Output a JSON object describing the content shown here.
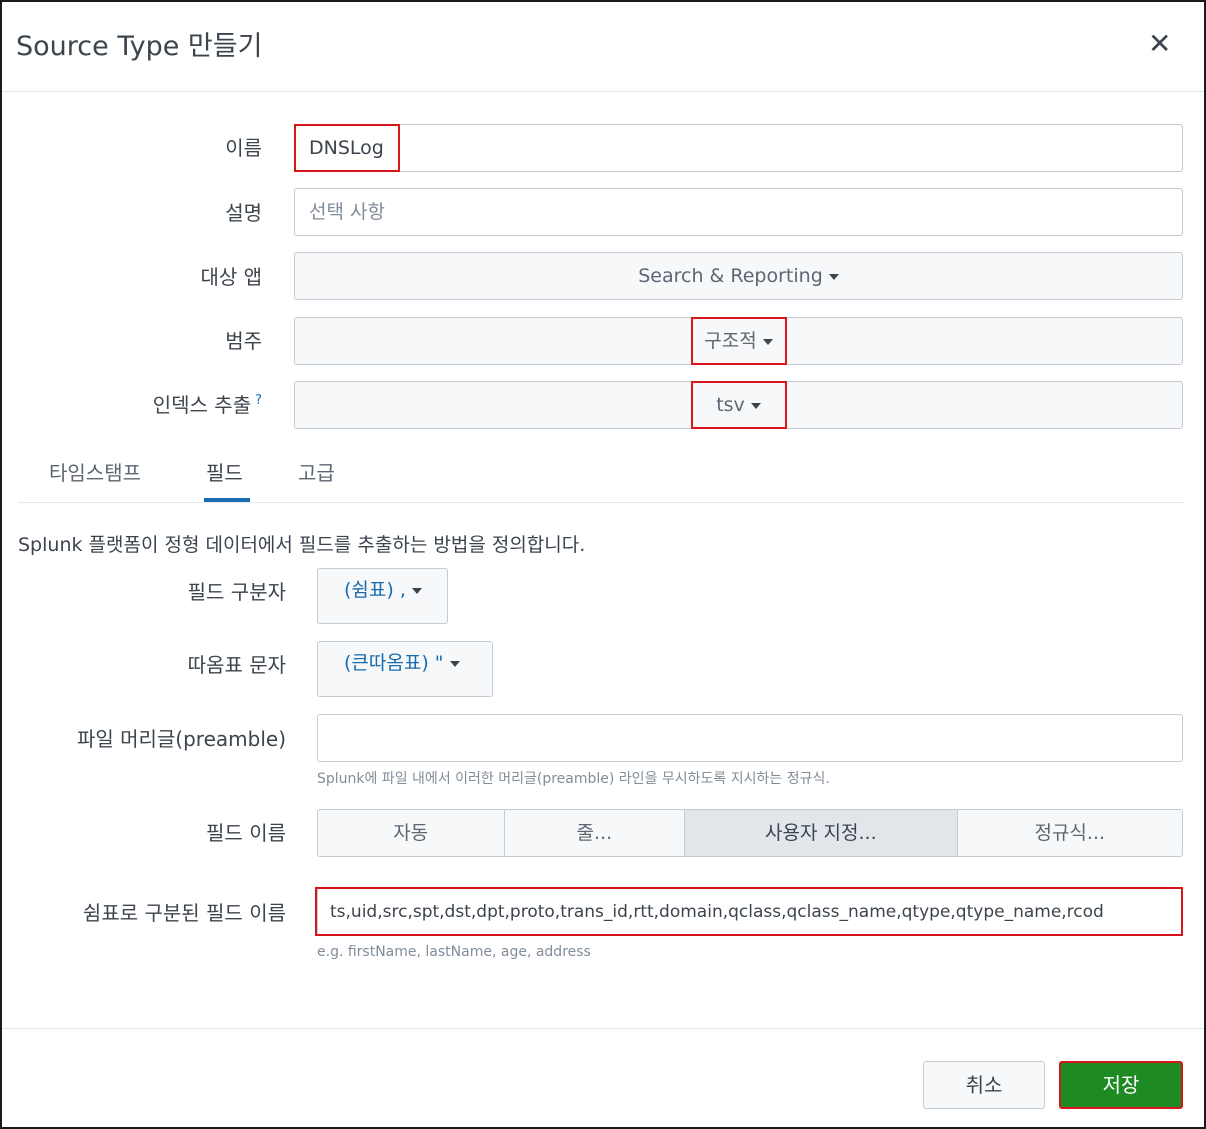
{
  "dialog": {
    "title": "Source Type 만들기",
    "close_glyph": "✕"
  },
  "form": {
    "name_label": "이름",
    "name_value": "DNSLog",
    "description_label": "설명",
    "description_placeholder": "선택 사항",
    "target_app_label": "대상 앱",
    "target_app_value": "Search & Reporting",
    "category_label": "범주",
    "category_value": "구조적",
    "index_extraction_label": "인덱스 추출",
    "index_extraction_help": "?",
    "index_extraction_value": "tsv"
  },
  "tabs": [
    {
      "label": "타임스탬프",
      "active": false
    },
    {
      "label": "필드",
      "active": true
    },
    {
      "label": "고급",
      "active": false
    }
  ],
  "fields_tab": {
    "description": "Splunk 플랫폼이 정형 데이터에서 필드를 추출하는 방법을 정의합니다.",
    "delimiter_label": "필드 구분자",
    "delimiter_value": "(쉼표) ,",
    "quote_label": "따옴표 문자",
    "quote_value": "(큰따옴표) \"",
    "preamble_label": "파일 머리글(preamble)",
    "preamble_value": "",
    "preamble_help": "Splunk에 파일 내에서 이러한 머리글(preamble) 라인을 무시하도록 지시하는 정규식.",
    "field_names_label": "필드 이름",
    "field_names_options": [
      {
        "label": "자동",
        "active": false
      },
      {
        "label": "줄...",
        "active": false
      },
      {
        "label": "사용자 지정...",
        "active": true
      },
      {
        "label": "정규식...",
        "active": false
      }
    ],
    "csv_names_label": "쉼표로 구분된 필드 이름",
    "csv_names_value": "ts,uid,src,spt,dst,dpt,proto,trans_id,rtt,domain,qclass,qclass_name,qtype,qtype_name,rcod",
    "csv_names_help": "e.g. firstName, lastName, age, address"
  },
  "footer": {
    "cancel_label": "취소",
    "save_label": "저장"
  },
  "colors": {
    "highlight": "#d9141a",
    "save_button": "#1e8a24",
    "link_blue": "#1a6cae"
  }
}
